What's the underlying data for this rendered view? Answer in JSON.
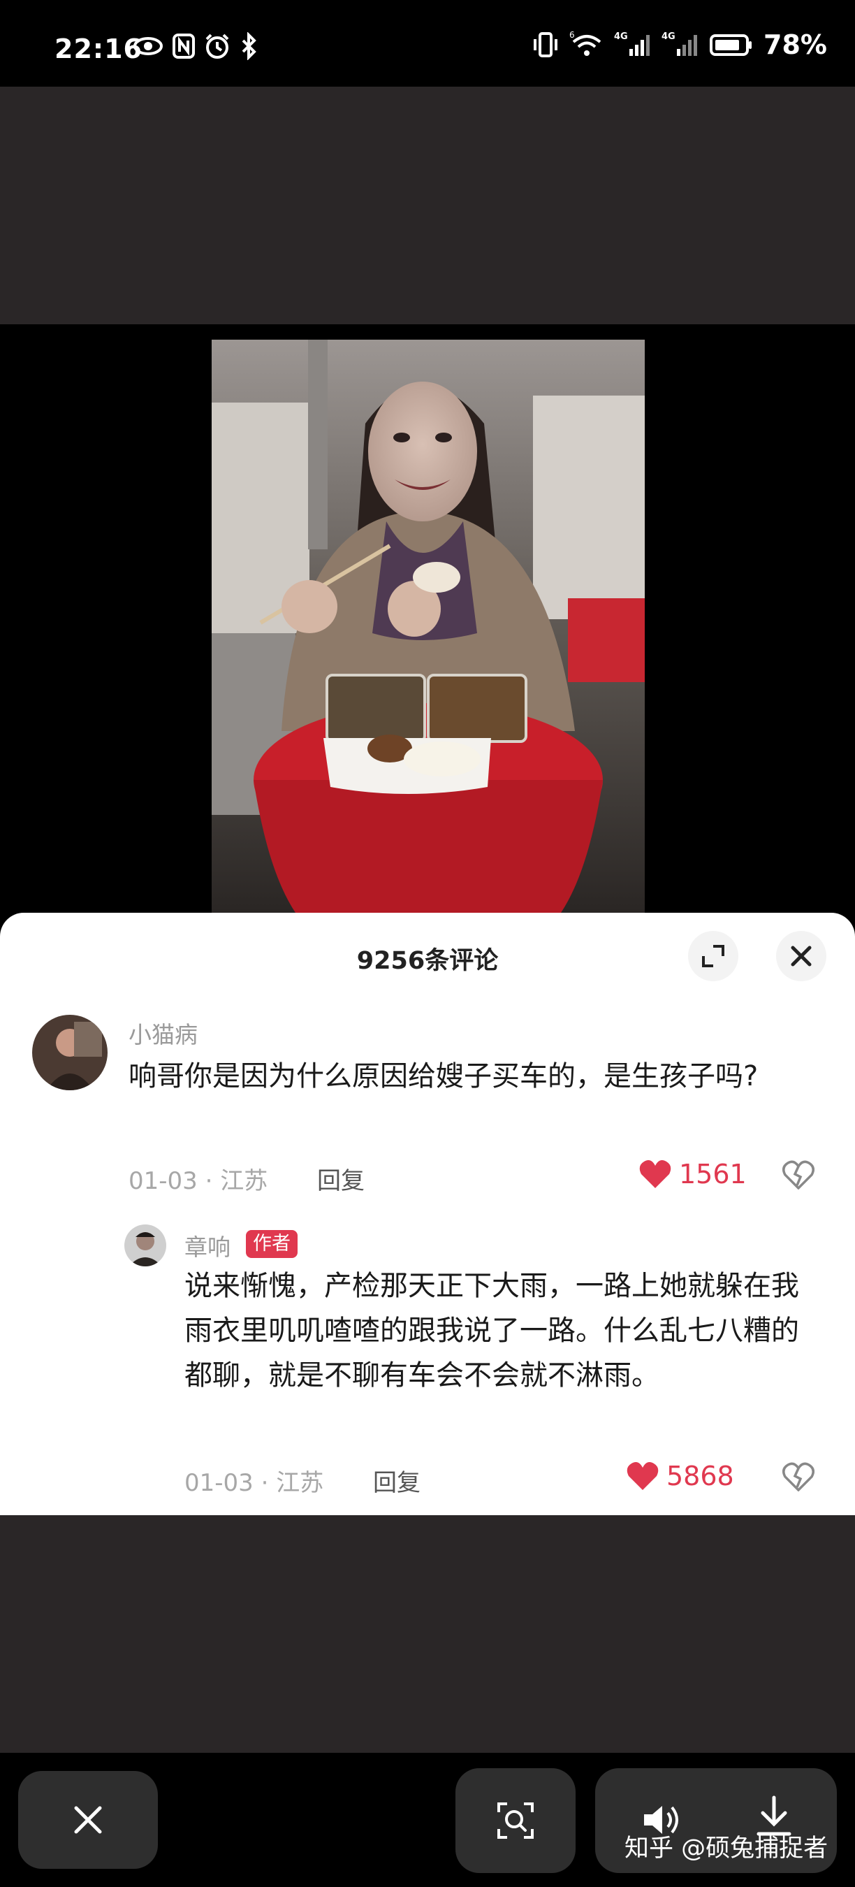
{
  "status_bar": {
    "time": "22:16",
    "icons_left": [
      "eye-icon",
      "nfc-icon",
      "alarm-icon",
      "bluetooth-icon"
    ],
    "icons_right": [
      "vibrate-icon",
      "wifi-6-icon",
      "signal-4g-icon",
      "signal-4g-icon",
      "battery-icon"
    ],
    "network_labels": [
      "4G",
      "4G"
    ],
    "wifi_label": "6",
    "battery": "78%"
  },
  "sheet": {
    "title": "9256条评论",
    "expand_icon": "expand-icon",
    "close_icon": "close-icon"
  },
  "comments": [
    {
      "username": "小猫病",
      "text": "响哥你是因为什么原因给嫂子买车的，是生孩子吗?",
      "date": "01-03",
      "location": "江苏",
      "reply_label": "回复",
      "likes": "1561"
    }
  ],
  "replies": [
    {
      "username": "章响",
      "badge": "作者",
      "text": "说来惭愧，产检那天正下大雨，一路上她就躲在我雨衣里叽叽喳喳的跟我说了一路。什么乱七八糟的都聊，就是不聊有车会不会就不淋雨。",
      "date": "01-03",
      "location": "江苏",
      "reply_label": "回复",
      "likes": "5868"
    }
  ],
  "bottom_bar": {
    "buttons": [
      "close-icon",
      "image-search-icon",
      "volume-icon",
      "download-icon"
    ]
  },
  "watermark": "知乎 @硕兔捕捉者",
  "colors": {
    "accent": "#e0384f",
    "dark_bg": "#2a2627"
  }
}
